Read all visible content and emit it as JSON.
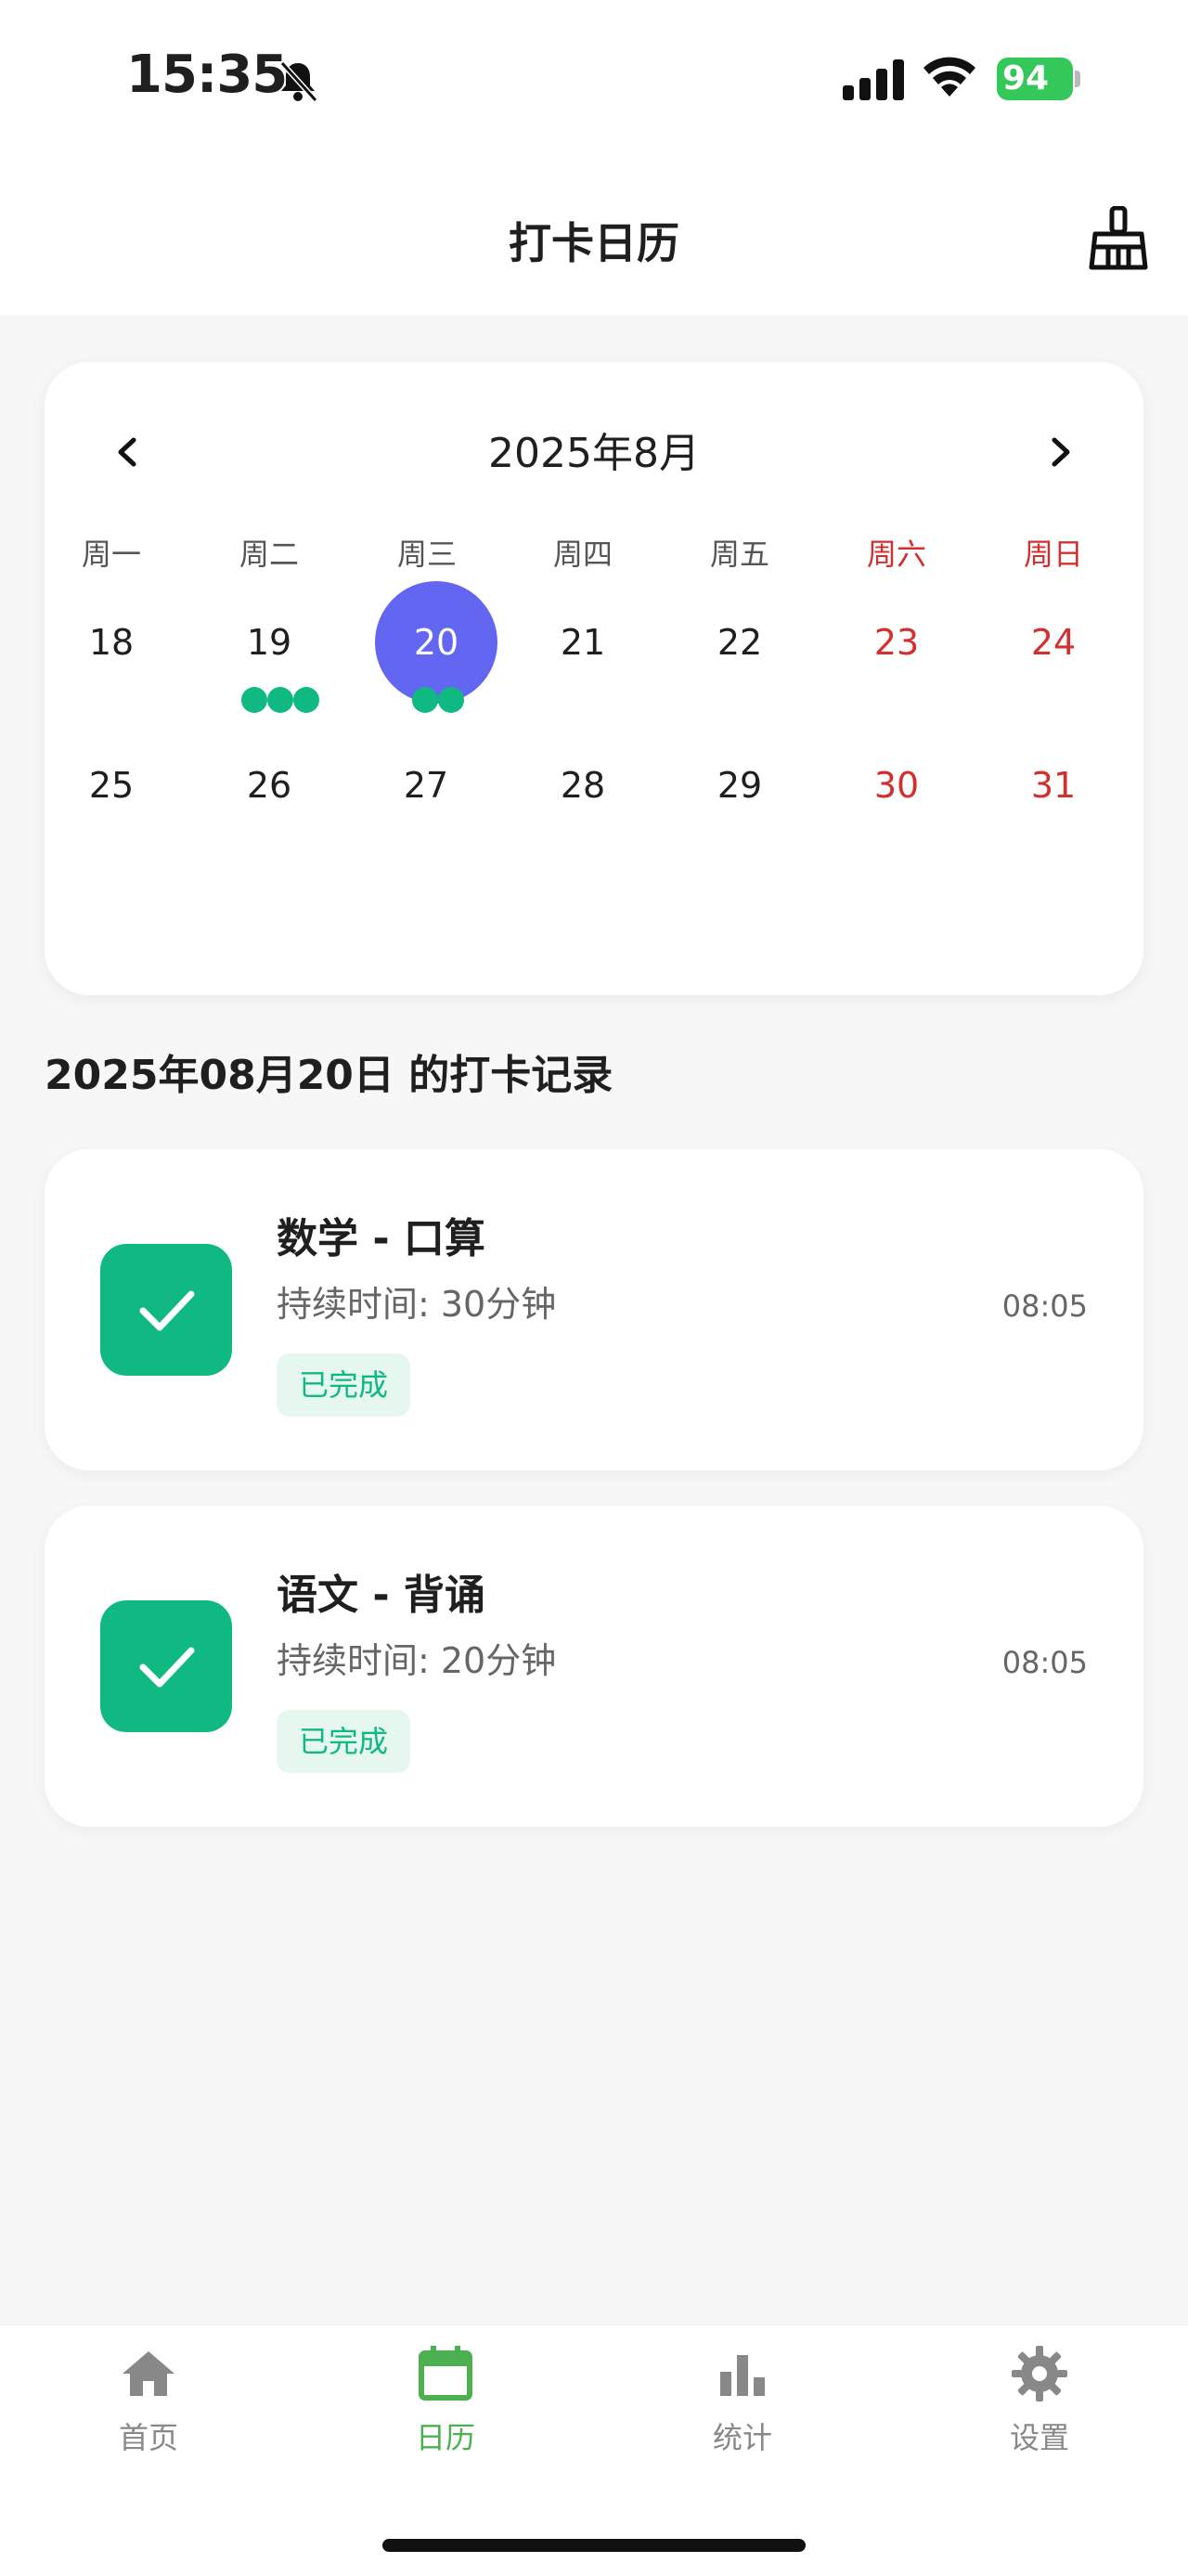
{
  "status_bar": {
    "time": "15:35",
    "battery": "94"
  },
  "header": {
    "title": "打卡日历"
  },
  "calendar": {
    "month_label": "2025年8月",
    "weekdays": [
      "周一",
      "周二",
      "周三",
      "周四",
      "周五",
      "周六",
      "周日"
    ],
    "week1": [
      "18",
      "19",
      "20",
      "21",
      "22",
      "23",
      "24"
    ],
    "week2": [
      "25",
      "26",
      "27",
      "28",
      "29",
      "30",
      "31"
    ],
    "selected_day": "20",
    "checkin_dots": {
      "19": 3,
      "20": 2
    }
  },
  "records_section": {
    "title": "2025年08月20日 的打卡记录"
  },
  "records": [
    {
      "title": "数学 - 口算",
      "duration": "持续时间: 30分钟",
      "status": "已完成",
      "time": "08:05"
    },
    {
      "title": "语文 - 背诵",
      "duration": "持续时间: 20分钟",
      "status": "已完成",
      "time": "08:05"
    }
  ],
  "tab_bar": {
    "tabs": [
      {
        "label": "首页",
        "icon": "home-icon"
      },
      {
        "label": "日历",
        "icon": "calendar-icon"
      },
      {
        "label": "统计",
        "icon": "bar-chart-icon"
      },
      {
        "label": "设置",
        "icon": "gear-icon"
      }
    ],
    "active_index": 1
  },
  "colors": {
    "accent": "#6366f1",
    "success": "#10b981",
    "weekend": "#d32f2f",
    "tab_active": "#4caf50"
  }
}
